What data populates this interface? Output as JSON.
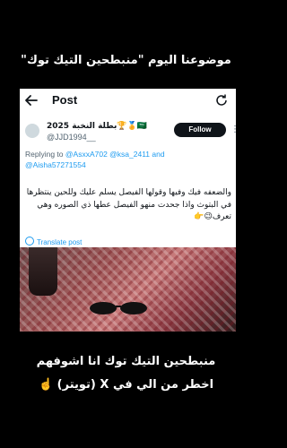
{
  "top_caption": "موضوعنا اليوم \"منبطحين التيك توك\"",
  "post_header": {
    "title": "Post"
  },
  "tweet": {
    "display_name": "بطلة النخبة 2025🏆🏅🇸🇦",
    "handle": "@JJD1994__",
    "follow_label": "Follow",
    "reply_prefix": "Replying to",
    "mentions_line1": "@AsxxA702 @ksa_2411 and",
    "mentions_line2": "@Aisha57271554",
    "text": "والضعفه فيك وفيها وقولها الفيصل يسلم عليك وللحين ينتظرها في البتوث واذا جحدت منهو الفيصل عطها ذي الصوره وهي تعرف😉👉",
    "translate_label": "Translate post"
  },
  "bottom_caption": {
    "line1": "منبطحين التيك توك انا اشوفهم",
    "line2": "اخطر من الي في X (تويتر) ☝️"
  },
  "colors": {
    "link": "#1d9bf0",
    "follow_bg": "#0f1419",
    "muted": "#536471"
  }
}
